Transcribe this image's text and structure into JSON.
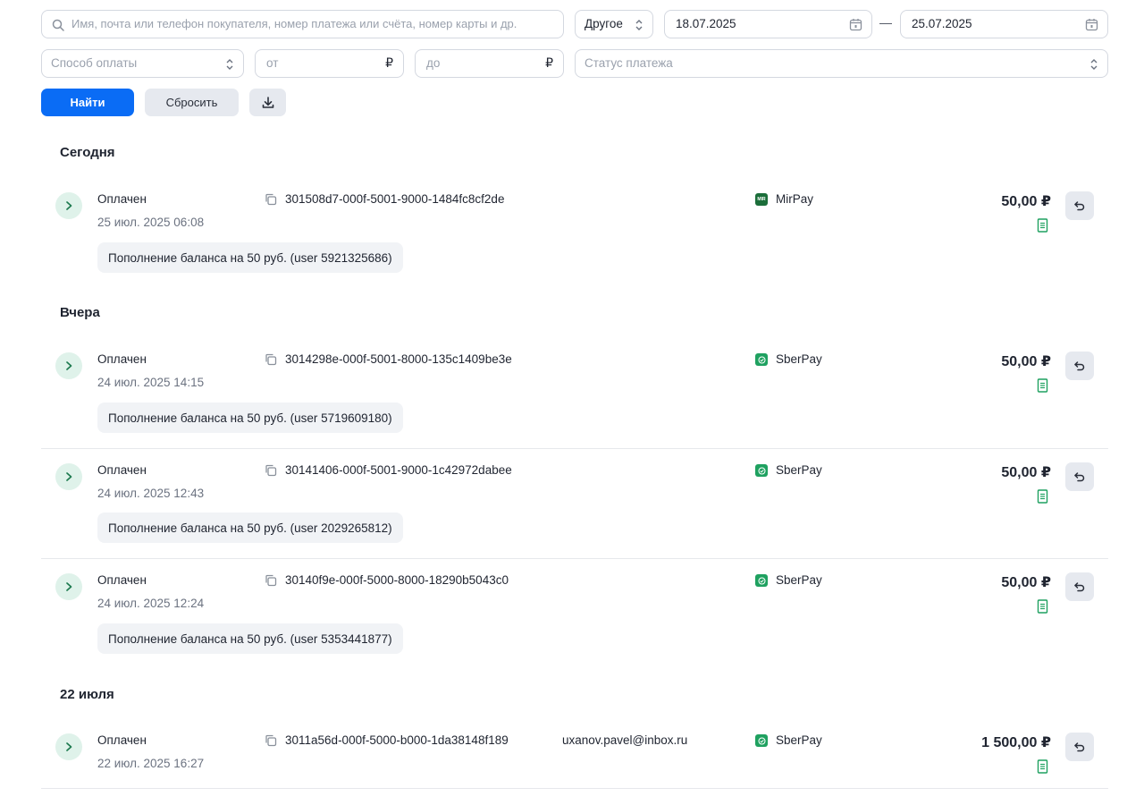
{
  "filters": {
    "search_placeholder": "Имя, почта или телефон покупателя, номер платежа или счёта, номер карты и др.",
    "period_select": "Другое",
    "date_from": "18.07.2025",
    "date_separator": "—",
    "date_to": "25.07.2025",
    "payment_method_placeholder": "Способ оплаты",
    "amount_from_placeholder": "от",
    "amount_to_placeholder": "до",
    "currency_symbol": "₽",
    "payment_status_placeholder": "Статус платежа",
    "find_label": "Найти",
    "reset_label": "Сбросить"
  },
  "groups": [
    {
      "title": "Сегодня",
      "payments": [
        {
          "status": "Оплачен",
          "date": "25 июл. 2025 06:08",
          "id": "301508d7-000f-5001-9000-1484fc8cf2de",
          "email": "",
          "method": "MirPay",
          "method_icon": "mirpay-icon",
          "amount": "50,00 ₽",
          "description": "Пополнение баланса на 50 руб. (user 5921325686)"
        }
      ]
    },
    {
      "title": "Вчера",
      "payments": [
        {
          "status": "Оплачен",
          "date": "24 июл. 2025 14:15",
          "id": "3014298e-000f-5001-8000-135c1409be3e",
          "email": "",
          "method": "SberPay",
          "method_icon": "sberpay-icon",
          "amount": "50,00 ₽",
          "description": "Пополнение баланса на 50 руб. (user 5719609180)"
        },
        {
          "status": "Оплачен",
          "date": "24 июл. 2025 12:43",
          "id": "30141406-000f-5001-9000-1c42972dabee",
          "email": "",
          "method": "SberPay",
          "method_icon": "sberpay-icon",
          "amount": "50,00 ₽",
          "description": "Пополнение баланса на 50 руб. (user 2029265812)"
        },
        {
          "status": "Оплачен",
          "date": "24 июл. 2025 12:24",
          "id": "30140f9e-000f-5000-8000-18290b5043c0",
          "email": "",
          "method": "SberPay",
          "method_icon": "sberpay-icon",
          "amount": "50,00 ₽",
          "description": "Пополнение баланса на 50 руб. (user 5353441877)"
        }
      ]
    },
    {
      "title": "22 июля",
      "payments": [
        {
          "status": "Оплачен",
          "date": "22 июл. 2025 16:27",
          "id": "3011a56d-000f-5000-b000-1da38148f189",
          "email": "uxanov.pavel@inbox.ru",
          "method": "SberPay",
          "method_icon": "sberpay-icon",
          "amount": "1 500,00 ₽",
          "description": ""
        }
      ]
    }
  ],
  "colors": {
    "primary": "#0a6cf5",
    "success": "#1fa160",
    "mirpay": "#1b6e3a"
  }
}
